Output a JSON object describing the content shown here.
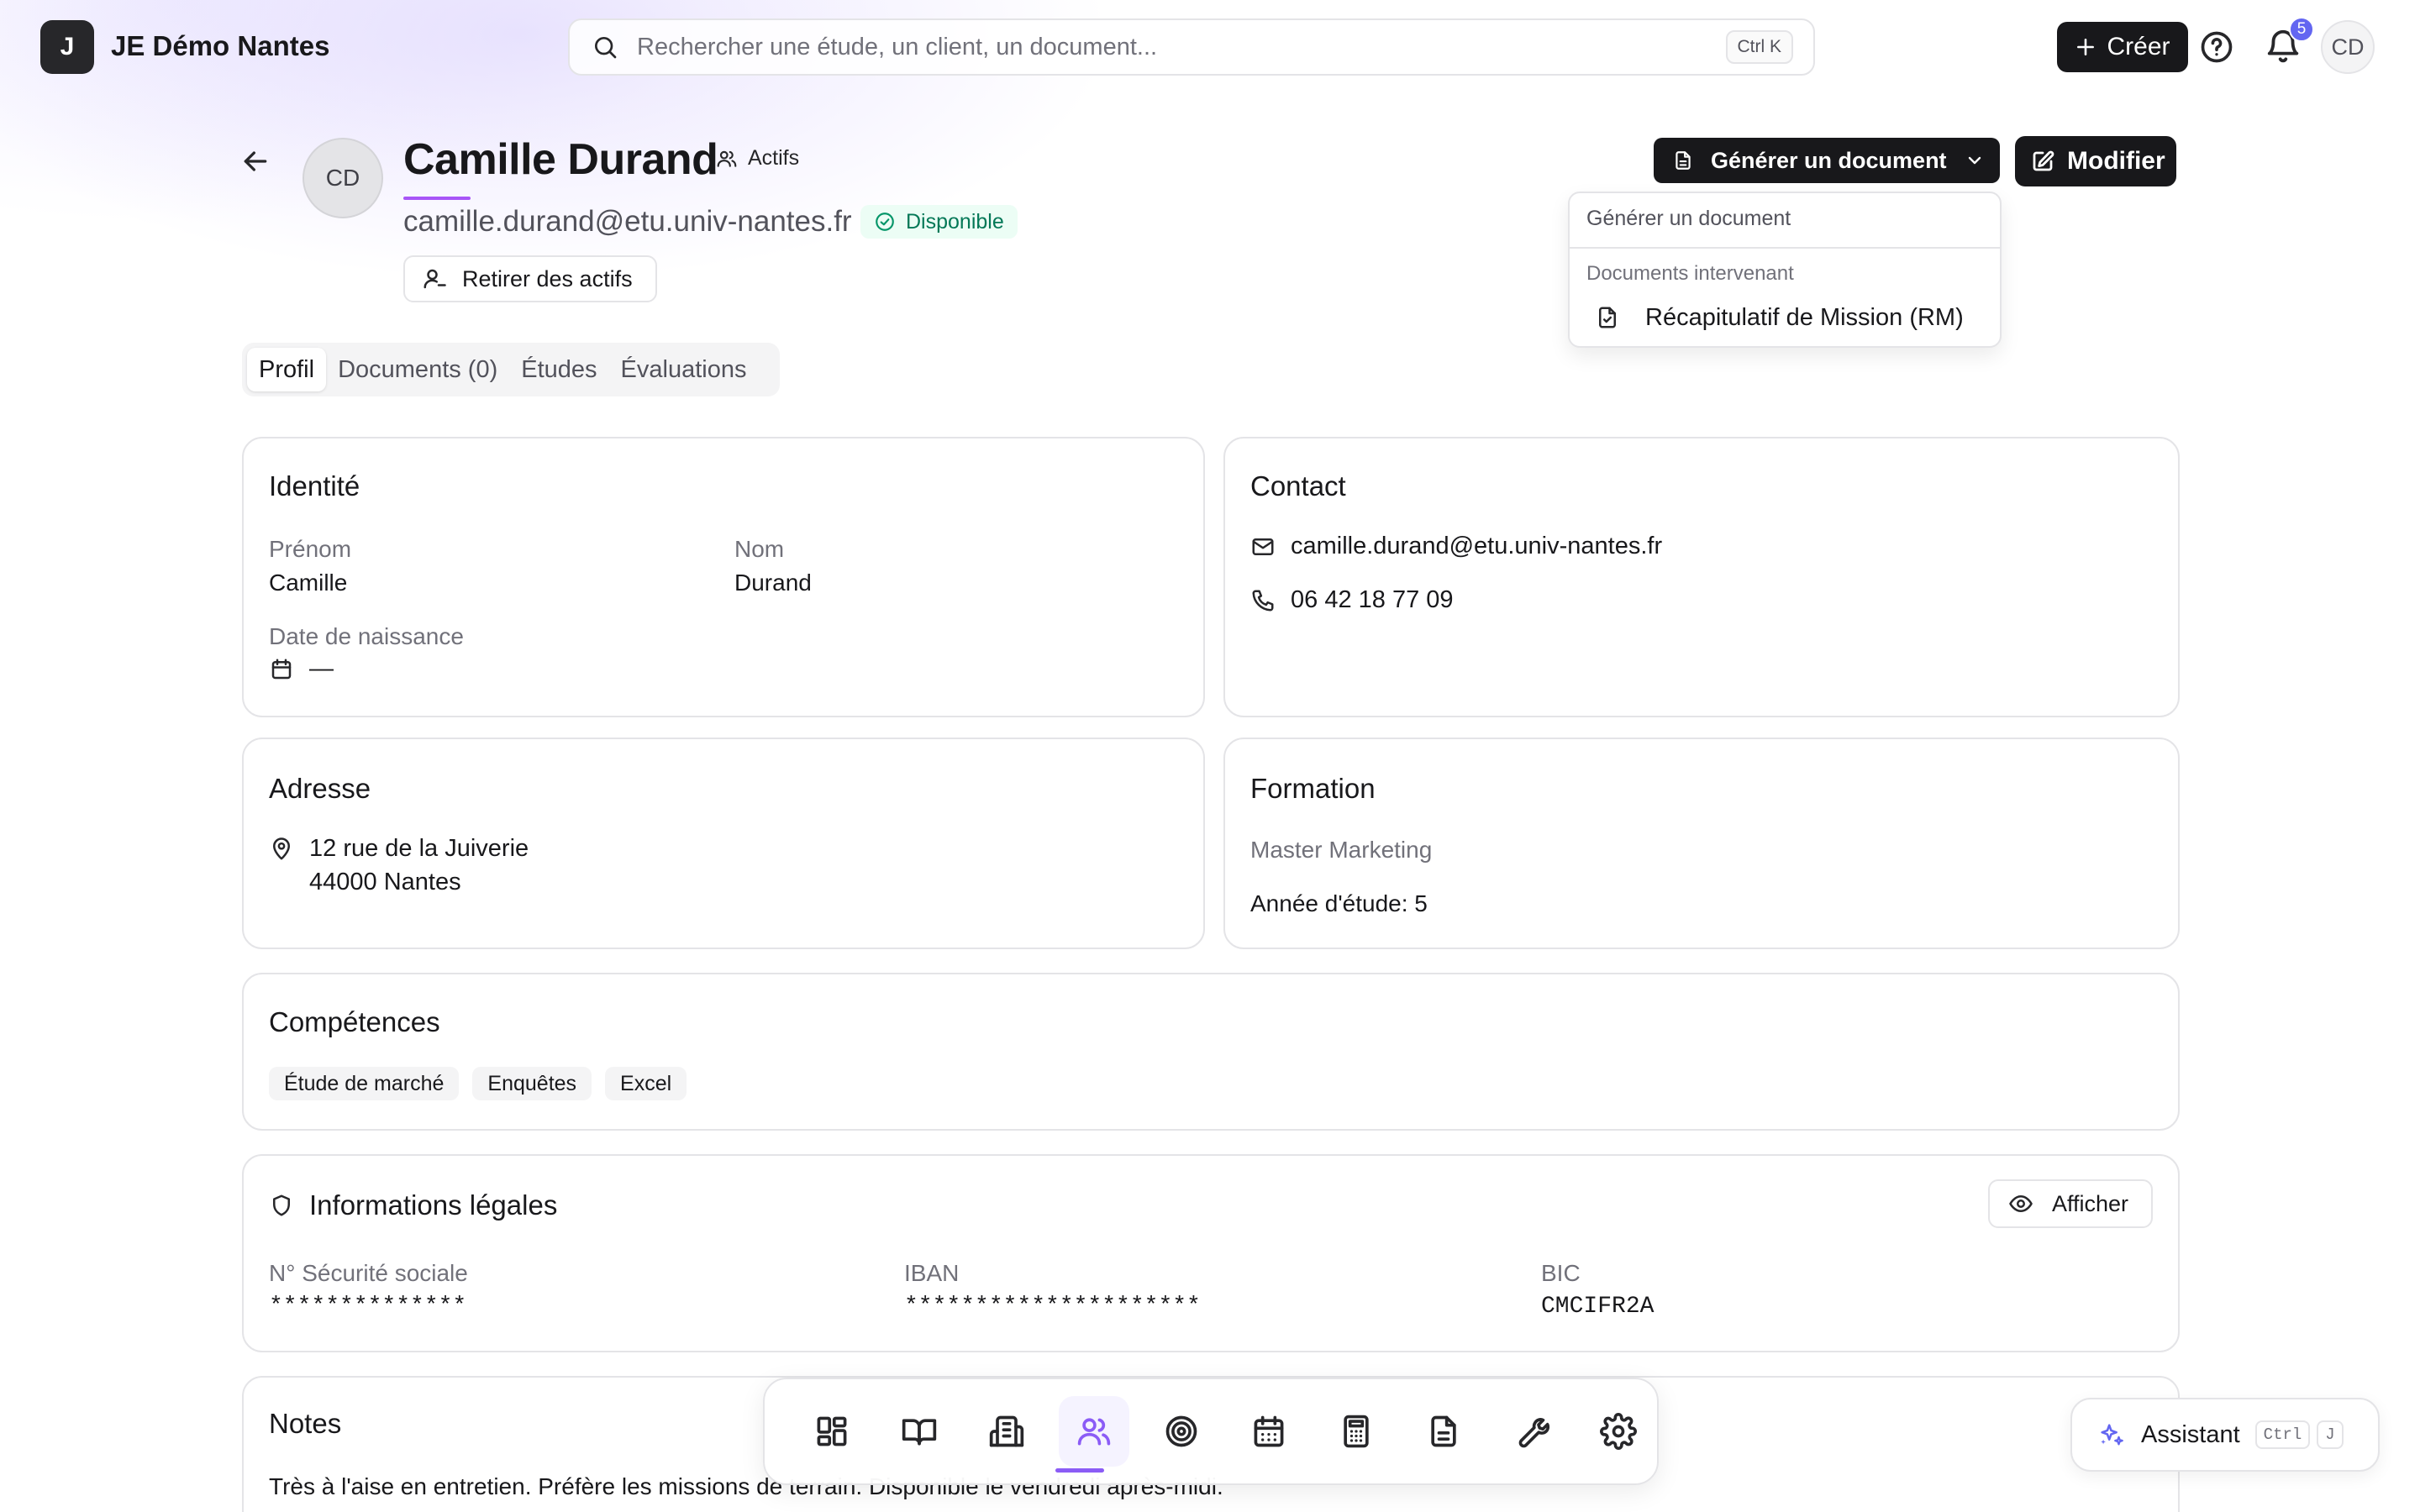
{
  "app": {
    "logo_letter": "J",
    "name": "JE Démo Nantes"
  },
  "search": {
    "placeholder": "Rechercher une étude, un client, un document...",
    "shortcut": "Ctrl K"
  },
  "topbar": {
    "create_label": "Créer",
    "notification_count": "5",
    "user_initials": "CD"
  },
  "profile": {
    "initials": "CD",
    "name": "Camille Durand",
    "group_tag": "Actifs",
    "email": "camille.durand@etu.univ-nantes.fr",
    "availability": "Disponible",
    "remove_label": "Retirer des actifs"
  },
  "actions": {
    "generate_label": "Générer un document",
    "edit_label": "Modifier",
    "dropdown": {
      "header": "Générer un document",
      "group": "Documents intervenant",
      "items": [
        "Récapitulatif de Mission (RM)"
      ]
    }
  },
  "tabs": [
    {
      "label": "Profil",
      "active": true
    },
    {
      "label": "Documents (0)",
      "active": false
    },
    {
      "label": "Études",
      "active": false
    },
    {
      "label": "Évaluations",
      "active": false
    }
  ],
  "identity": {
    "title": "Identité",
    "first_name_label": "Prénom",
    "first_name": "Camille",
    "last_name_label": "Nom",
    "last_name": "Durand",
    "birth_label": "Date de naissance",
    "birth_value": "—"
  },
  "contact": {
    "title": "Contact",
    "email": "camille.durand@etu.univ-nantes.fr",
    "phone": "06 42 18 77 09"
  },
  "address": {
    "title": "Adresse",
    "line1": "12 rue de la Juiverie",
    "line2": "44000 Nantes"
  },
  "education": {
    "title": "Formation",
    "program": "Master Marketing",
    "year": "Année d'étude: 5"
  },
  "skills": {
    "title": "Compétences",
    "items": [
      "Étude de marché",
      "Enquêtes",
      "Excel"
    ]
  },
  "legal": {
    "title": "Informations légales",
    "show_label": "Afficher",
    "ssn_label": "N° Sécurité sociale",
    "ssn_value": "**************",
    "iban_label": "IBAN",
    "iban_value": "*********************",
    "bic_label": "BIC",
    "bic_value": "CMCIFR2A"
  },
  "notes": {
    "title": "Notes",
    "text": "Très à l'aise en entretien. Préfère les missions de terrain. Disponible le vendredi après-midi."
  },
  "dock": {
    "items": [
      "dashboard-icon",
      "book-icon",
      "building-icon",
      "users-icon",
      "target-icon",
      "calendar-icon",
      "calculator-icon",
      "document-icon",
      "wrench-icon",
      "settings-icon"
    ],
    "active_index": 3,
    "accent": "#8b5cf6"
  },
  "assistant": {
    "label": "Assistant",
    "key1": "Ctrl",
    "key2": "J"
  }
}
